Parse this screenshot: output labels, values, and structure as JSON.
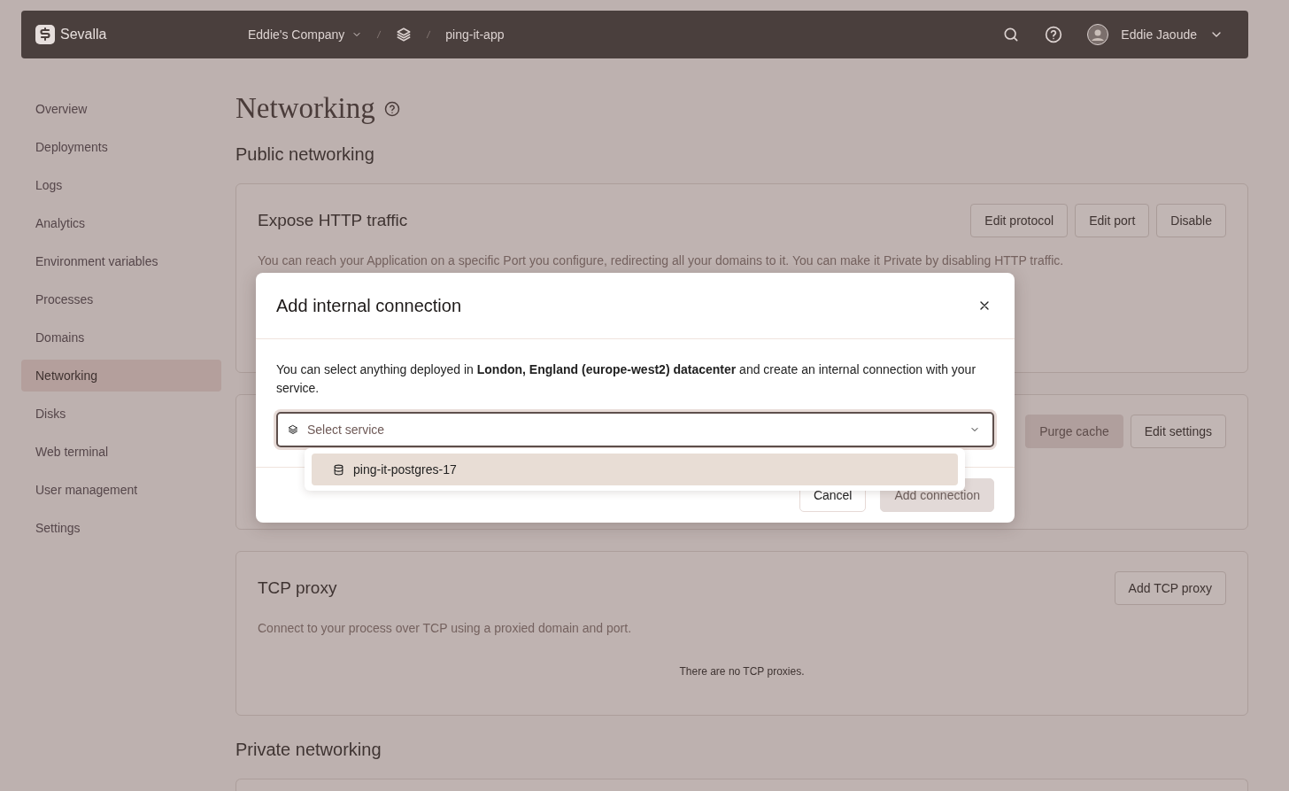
{
  "topbar": {
    "brand": "Sevalla",
    "breadcrumbs": [
      {
        "kind": "dropdown",
        "label": "Eddie's Company"
      },
      {
        "kind": "icon"
      },
      {
        "kind": "text",
        "label": "ping-it-app"
      }
    ],
    "user_name": "Eddie Jaoude"
  },
  "sidebar": {
    "items": [
      {
        "label": "Overview",
        "selected": false
      },
      {
        "label": "Deployments",
        "selected": false
      },
      {
        "label": "Logs",
        "selected": false
      },
      {
        "label": "Analytics",
        "selected": false
      },
      {
        "label": "Environment variables",
        "selected": false
      },
      {
        "label": "Processes",
        "selected": false
      },
      {
        "label": "Domains",
        "selected": false
      },
      {
        "label": "Networking",
        "selected": true
      },
      {
        "label": "Disks",
        "selected": false
      },
      {
        "label": "Web terminal",
        "selected": false
      },
      {
        "label": "User management",
        "selected": false
      },
      {
        "label": "Settings",
        "selected": false
      }
    ]
  },
  "page": {
    "title": "Networking",
    "sections": [
      {
        "heading": "Public networking",
        "cards": [
          {
            "title": "Expose HTTP traffic",
            "description": "You can reach your Application on a specific Port you configure, redirecting all your domains to it. You can make it Private by disabling HTTP traffic.",
            "buttons": [
              {
                "label": "Edit protocol",
                "disabled": false
              },
              {
                "label": "Edit port",
                "disabled": false
              },
              {
                "label": "Disable",
                "disabled": false
              }
            ]
          },
          {
            "buttons": [
              {
                "label": "Purge cache",
                "disabled": true
              },
              {
                "label": "Edit settings",
                "disabled": false
              }
            ]
          },
          {
            "title": "TCP proxy",
            "description": "Connect to your process over TCP using a proxied domain and port.",
            "buttons": [
              {
                "label": "Add TCP proxy",
                "disabled": false
              }
            ],
            "empty_text": "There are no TCP proxies."
          }
        ]
      },
      {
        "heading": "Private networking",
        "cards": [
          {
            "kind": "cut_off"
          }
        ]
      }
    ]
  },
  "modal": {
    "title": "Add internal connection",
    "text": "You can select anything deployed in **London, England (europe-west2) datacenter** and create an internal connection with your service.",
    "select": {
      "placeholder": "Select service",
      "options": [
        {
          "label": "ping-it-postgres-17",
          "selected": true
        }
      ]
    },
    "buttons": [
      {
        "label": "Cancel",
        "kind": "secondary",
        "disabled": false
      },
      {
        "label": "Add connection",
        "kind": "primary",
        "disabled": true
      }
    ]
  }
}
